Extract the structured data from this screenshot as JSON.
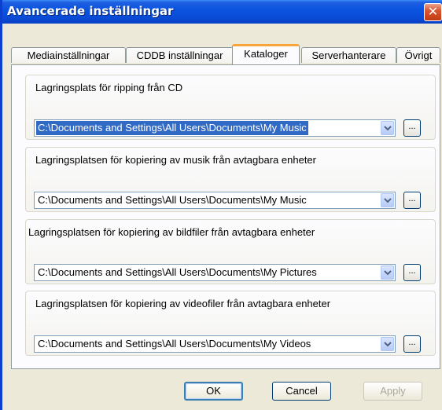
{
  "window": {
    "title": "Avancerade inställningar",
    "close_glyph": "✕"
  },
  "tabs": [
    {
      "label": "Mediainställningar"
    },
    {
      "label": "CDDB inställningar"
    },
    {
      "label": "Kataloger"
    },
    {
      "label": "Serverhanterare"
    },
    {
      "label": "Övrigt"
    }
  ],
  "groups": [
    {
      "label": "Lagringsplats för ripping från CD",
      "path": "C:\\Documents and Settings\\All Users\\Documents\\My Music",
      "browse": "..."
    },
    {
      "label": "Lagringsplatsen för kopiering av musik från avtagbara enheter",
      "path": "C:\\Documents and Settings\\All Users\\Documents\\My Music",
      "browse": "..."
    },
    {
      "label": "Lagringsplatsen för kopiering av bildfiler från avtagbara enheter",
      "path": "C:\\Documents and Settings\\All Users\\Documents\\My Pictures",
      "browse": "..."
    },
    {
      "label": "Lagringsplatsen för kopiering av videofiler från avtagbara enheter",
      "path": "C:\\Documents and Settings\\All Users\\Documents\\My Videos",
      "browse": "..."
    }
  ],
  "buttons": {
    "ok": "OK",
    "cancel": "Cancel",
    "apply": "Apply"
  },
  "colors": {
    "title_bar": "#0a4bd6",
    "active_tab_accent": "#f7a43a",
    "selection": "#316ac5"
  }
}
